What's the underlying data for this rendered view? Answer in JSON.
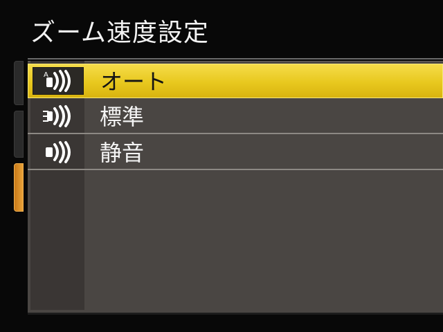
{
  "header": {
    "title": "ズーム速度設定"
  },
  "menu": {
    "items": [
      {
        "label": "オート",
        "icon": "zoom-speed-auto-icon",
        "selected": true
      },
      {
        "label": "標準",
        "icon": "zoom-speed-normal-icon",
        "selected": false
      },
      {
        "label": "静音",
        "icon": "zoom-speed-silent-icon",
        "selected": false
      }
    ]
  },
  "colors": {
    "highlight": "#e8c81e",
    "active_tab": "#e8a23a",
    "panel": "#4a4643"
  }
}
